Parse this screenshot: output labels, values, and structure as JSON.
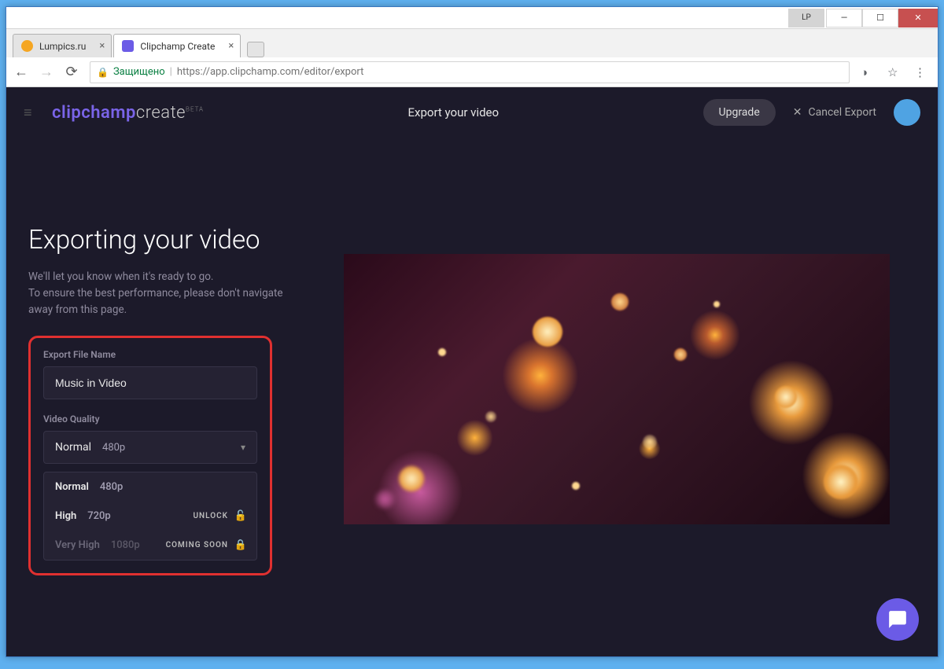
{
  "window": {
    "lp": "LP"
  },
  "tabs": [
    {
      "title": "Lumpics.ru"
    },
    {
      "title": "Clipchamp Create"
    }
  ],
  "addr": {
    "secure": "Защищено",
    "url": "https://app.clipchamp.com/editor/export"
  },
  "header": {
    "title": "Export your video",
    "upgrade": "Upgrade",
    "cancel": "Cancel Export"
  },
  "logo": {
    "a": "clipchamp",
    "b": "create",
    "beta": "BETA"
  },
  "side": {
    "title": "Exporting your video",
    "desc1": "We'll let you know when it's ready to go.",
    "desc2": "To ensure the best performance, please don't navigate away from this page."
  },
  "panel": {
    "fileLabel": "Export File Name",
    "fileName": "Music in Video",
    "qualityLabel": "Video Quality",
    "selected": {
      "name": "Normal",
      "res": "480p"
    },
    "options": [
      {
        "name": "Normal",
        "res": "480p",
        "tag": "",
        "lock": false
      },
      {
        "name": "High",
        "res": "720p",
        "tag": "UNLOCK",
        "lock": true
      },
      {
        "name": "Very High",
        "res": "1080p",
        "tag": "COMING SOON",
        "lock": true,
        "disabled": true
      }
    ]
  }
}
